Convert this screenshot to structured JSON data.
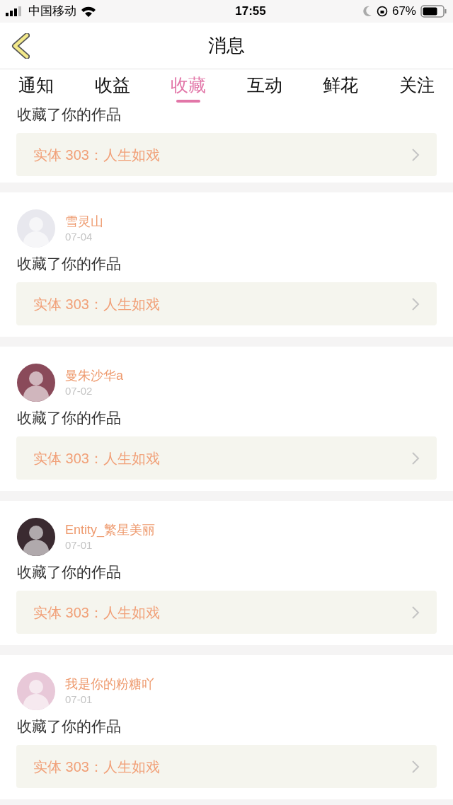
{
  "status_bar": {
    "carrier": "中国移动",
    "time": "17:55",
    "battery": "67%"
  },
  "header": {
    "title": "消息"
  },
  "tabs": [
    {
      "label": "通知",
      "selected": false
    },
    {
      "label": "收益",
      "selected": false
    },
    {
      "label": "收藏",
      "selected": true
    },
    {
      "label": "互动",
      "selected": false
    },
    {
      "label": "鲜花",
      "selected": false
    },
    {
      "label": "关注",
      "selected": false
    }
  ],
  "partial_item": {
    "text": "收藏了你的作品",
    "work": "实体 303：人生如戏"
  },
  "items": [
    {
      "user": "雪灵山",
      "date": "07-04",
      "text": "收藏了你的作品",
      "work": "实体 303：人生如戏",
      "color": "#e8e8ee"
    },
    {
      "user": "曼朱沙华a",
      "date": "07-02",
      "text": "收藏了你的作品",
      "work": "实体 303：人生如戏",
      "color": "#8a4a5a"
    },
    {
      "user": "Entity_繁星美丽",
      "date": "07-01",
      "text": "收藏了你的作品",
      "work": "实体 303：人生如戏",
      "color": "#3a2a30"
    },
    {
      "user": "我是你的粉糖吖",
      "date": "07-01",
      "text": "收藏了你的作品",
      "work": "实体 303：人生如戏",
      "color": "#e8c8d8"
    }
  ]
}
